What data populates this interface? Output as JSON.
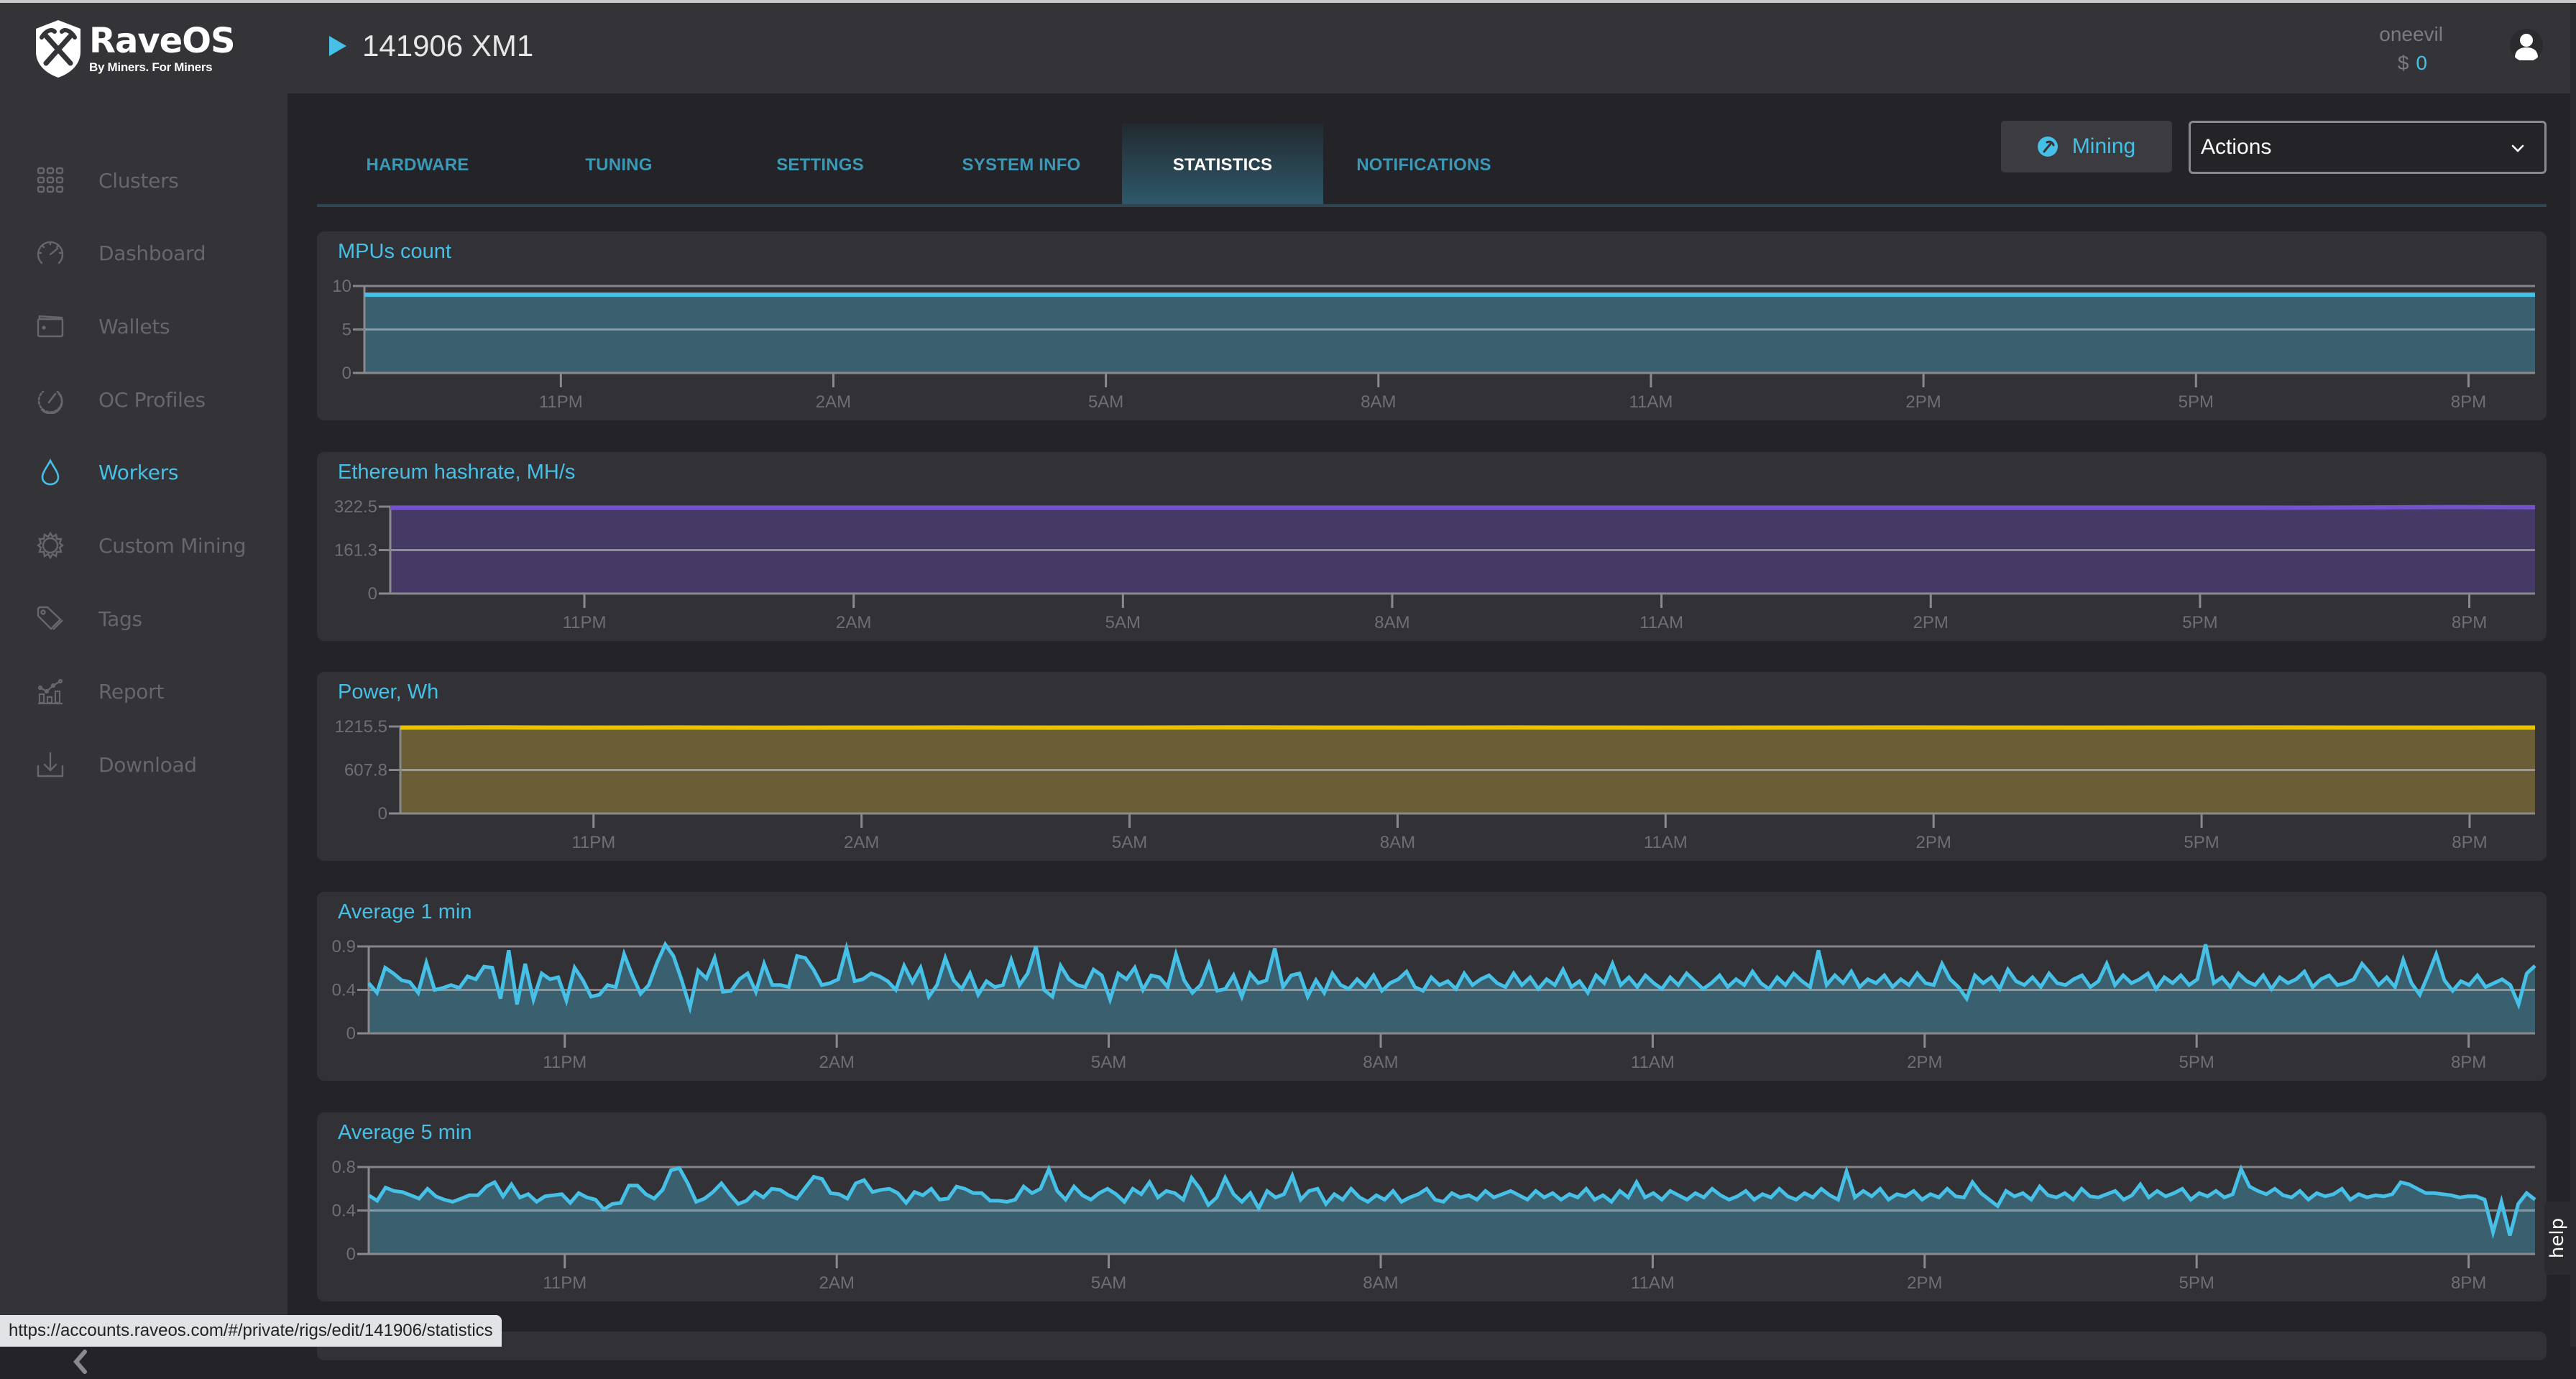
{
  "app": {
    "logo_name": "RaveOS",
    "logo_tagline": "By Miners. For Miners",
    "rig_title": "141906 XM1"
  },
  "user": {
    "name": "oneevil",
    "currency": "$",
    "balance": "0"
  },
  "sidebar": {
    "items": [
      {
        "label": "Clusters",
        "icon": "grid-icon",
        "active": false
      },
      {
        "label": "Dashboard",
        "icon": "speedometer-icon",
        "active": false
      },
      {
        "label": "Wallets",
        "icon": "wallet-icon",
        "active": false
      },
      {
        "label": "OC Profiles",
        "icon": "gauge-icon",
        "active": false
      },
      {
        "label": "Workers",
        "icon": "drop-icon",
        "active": true
      },
      {
        "label": "Custom Mining",
        "icon": "gear-icon",
        "active": false
      },
      {
        "label": "Tags",
        "icon": "tag-icon",
        "active": false
      },
      {
        "label": "Report",
        "icon": "chart-icon",
        "active": false
      },
      {
        "label": "Download",
        "icon": "download-icon",
        "active": false
      }
    ],
    "collapse_icon": "chevron-left-icon"
  },
  "tabs": [
    {
      "label": "HARDWARE",
      "active": false
    },
    {
      "label": "TUNING",
      "active": false
    },
    {
      "label": "SETTINGS",
      "active": false
    },
    {
      "label": "SYSTEM INFO",
      "active": false
    },
    {
      "label": "STATISTICS",
      "active": true
    },
    {
      "label": "NOTIFICATIONS",
      "active": false
    }
  ],
  "toolbar": {
    "mining_label": "Mining",
    "mining_icon": "pickaxe-icon",
    "actions_label": "Actions"
  },
  "help_label": "help",
  "status_url": "https://accounts.raveos.com/#/private/rigs/edit/141906/statistics",
  "colors": {
    "accent": "#46c0e6",
    "mpus_line": "#46c0e6",
    "mpus_fill": "#3a5f6e",
    "hashrate_line": "#7452cc",
    "hashrate_fill": "#453a66",
    "power_line": "#e6c200",
    "power_fill": "#6b5d36",
    "avg_line": "#46c0e6",
    "avg_fill": "#3a5f6e"
  },
  "chart_data": [
    {
      "type": "area",
      "title": "MPUs count",
      "x_ticks": [
        "11PM",
        "2AM",
        "5AM",
        "8AM",
        "11AM",
        "2PM",
        "5PM",
        "8PM"
      ],
      "y_ticks": [
        "0",
        "5",
        "10"
      ],
      "ylim": [
        0,
        10
      ],
      "grid": true,
      "series": [
        {
          "name": "MPUs count",
          "values": [
            9,
            9,
            9,
            9,
            9,
            9,
            9,
            9,
            9,
            9,
            9,
            9,
            9,
            9,
            9,
            9,
            9,
            9,
            9,
            9,
            9,
            9,
            9,
            9
          ]
        }
      ]
    },
    {
      "type": "area",
      "title": "Ethereum hashrate, MH/s",
      "x_ticks": [
        "11PM",
        "2AM",
        "5AM",
        "8AM",
        "11AM",
        "2PM",
        "5PM",
        "8PM"
      ],
      "y_ticks": [
        "0",
        "161.3",
        "322.5"
      ],
      "ylim": [
        0,
        322.5
      ],
      "grid": true,
      "series": [
        {
          "name": "Hashrate",
          "values": [
            318,
            318,
            318,
            318,
            318,
            318,
            318,
            318,
            318,
            318,
            318,
            318,
            318,
            318,
            318,
            318,
            318,
            318,
            318,
            318,
            318,
            319,
            321,
            320
          ]
        }
      ]
    },
    {
      "type": "area",
      "title": "Power, Wh",
      "x_ticks": [
        "11PM",
        "2AM",
        "5AM",
        "8AM",
        "11AM",
        "2PM",
        "5PM",
        "8PM"
      ],
      "y_ticks": [
        "0",
        "607.8",
        "1215.5"
      ],
      "ylim": [
        0,
        1215.5
      ],
      "grid": true,
      "series": [
        {
          "name": "Power",
          "values": [
            1200,
            1202,
            1199,
            1201,
            1198,
            1200,
            1201,
            1199,
            1200,
            1202,
            1200,
            1199,
            1201,
            1200,
            1198,
            1200,
            1201,
            1200,
            1199,
            1200,
            1201,
            1200,
            1199,
            1200
          ]
        }
      ]
    },
    {
      "type": "area",
      "title": "Average 1 min",
      "x_ticks": [
        "11PM",
        "2AM",
        "5AM",
        "8AM",
        "11AM",
        "2PM",
        "5PM",
        "8PM"
      ],
      "y_ticks": [
        "0",
        "0.4",
        "0.9"
      ],
      "ylim": [
        0,
        0.9
      ],
      "grid": true,
      "series": [
        {
          "name": "Average 1 min",
          "values": [
            0.52,
            0.42,
            0.68,
            0.62,
            0.55,
            0.53,
            0.42,
            0.73,
            0.45,
            0.47,
            0.5,
            0.47,
            0.59,
            0.56,
            0.69,
            0.68,
            0.36,
            0.86,
            0.3,
            0.72,
            0.35,
            0.62,
            0.56,
            0.58,
            0.34,
            0.68,
            0.55,
            0.38,
            0.4,
            0.5,
            0.48,
            0.82,
            0.6,
            0.41,
            0.5,
            0.73,
            0.92,
            0.8,
            0.55,
            0.27,
            0.65,
            0.57,
            0.78,
            0.43,
            0.44,
            0.56,
            0.62,
            0.43,
            0.72,
            0.5,
            0.5,
            0.48,
            0.8,
            0.78,
            0.66,
            0.5,
            0.52,
            0.56,
            0.88,
            0.54,
            0.56,
            0.62,
            0.59,
            0.54,
            0.45,
            0.7,
            0.53,
            0.68,
            0.38,
            0.5,
            0.78,
            0.55,
            0.46,
            0.62,
            0.4,
            0.54,
            0.48,
            0.5,
            0.76,
            0.5,
            0.62,
            0.9,
            0.45,
            0.38,
            0.7,
            0.56,
            0.5,
            0.48,
            0.66,
            0.6,
            0.35,
            0.62,
            0.56,
            0.68,
            0.45,
            0.6,
            0.58,
            0.48,
            0.82,
            0.55,
            0.42,
            0.5,
            0.72,
            0.44,
            0.46,
            0.6,
            0.38,
            0.62,
            0.52,
            0.55,
            0.88,
            0.48,
            0.6,
            0.62,
            0.38,
            0.55,
            0.42,
            0.62,
            0.5,
            0.46,
            0.56,
            0.48,
            0.6,
            0.44,
            0.52,
            0.56,
            0.64,
            0.48,
            0.44,
            0.58,
            0.5,
            0.54,
            0.46,
            0.62,
            0.5,
            0.56,
            0.6,
            0.52,
            0.48,
            0.62,
            0.5,
            0.58,
            0.46,
            0.56,
            0.5,
            0.66,
            0.48,
            0.54,
            0.42,
            0.6,
            0.52,
            0.72,
            0.5,
            0.58,
            0.48,
            0.6,
            0.52,
            0.46,
            0.58,
            0.5,
            0.62,
            0.54,
            0.46,
            0.52,
            0.6,
            0.48,
            0.56,
            0.5,
            0.64,
            0.52,
            0.46,
            0.58,
            0.5,
            0.62,
            0.54,
            0.48,
            0.86,
            0.5,
            0.6,
            0.52,
            0.64,
            0.48,
            0.56,
            0.52,
            0.6,
            0.48,
            0.56,
            0.5,
            0.62,
            0.52,
            0.5,
            0.72,
            0.56,
            0.48,
            0.36,
            0.6,
            0.52,
            0.58,
            0.46,
            0.66,
            0.54,
            0.5,
            0.58,
            0.48,
            0.62,
            0.52,
            0.5,
            0.56,
            0.6,
            0.48,
            0.54,
            0.72,
            0.5,
            0.6,
            0.52,
            0.56,
            0.62,
            0.46,
            0.58,
            0.52,
            0.6,
            0.5,
            0.56,
            0.92,
            0.52,
            0.58,
            0.48,
            0.62,
            0.54,
            0.5,
            0.6,
            0.46,
            0.58,
            0.52,
            0.56,
            0.64,
            0.48,
            0.56,
            0.6,
            0.5,
            0.52,
            0.56,
            0.72,
            0.62,
            0.5,
            0.58,
            0.48,
            0.76,
            0.52,
            0.4,
            0.6,
            0.82,
            0.55,
            0.44,
            0.54,
            0.5,
            0.6,
            0.48,
            0.52,
            0.56,
            0.5,
            0.3,
            0.62,
            0.7
          ]
        }
      ]
    },
    {
      "type": "area",
      "title": "Average 5 min",
      "x_ticks": [
        "11PM",
        "2AM",
        "5AM",
        "8AM",
        "11AM",
        "2PM",
        "5PM",
        "8PM"
      ],
      "y_ticks": [
        "0",
        "0.4",
        "0.8"
      ],
      "ylim": [
        0,
        0.8
      ],
      "grid": true,
      "series": [
        {
          "name": "Average 5 min",
          "values": [
            0.54,
            0.49,
            0.61,
            0.58,
            0.57,
            0.54,
            0.51,
            0.6,
            0.53,
            0.5,
            0.48,
            0.51,
            0.54,
            0.54,
            0.62,
            0.66,
            0.53,
            0.64,
            0.52,
            0.55,
            0.48,
            0.53,
            0.54,
            0.55,
            0.47,
            0.56,
            0.52,
            0.5,
            0.41,
            0.46,
            0.47,
            0.63,
            0.63,
            0.55,
            0.51,
            0.59,
            0.77,
            0.79,
            0.65,
            0.48,
            0.51,
            0.57,
            0.65,
            0.55,
            0.46,
            0.49,
            0.57,
            0.52,
            0.6,
            0.59,
            0.54,
            0.51,
            0.61,
            0.71,
            0.69,
            0.56,
            0.55,
            0.51,
            0.65,
            0.68,
            0.57,
            0.59,
            0.6,
            0.56,
            0.47,
            0.57,
            0.54,
            0.6,
            0.5,
            0.51,
            0.62,
            0.6,
            0.56,
            0.56,
            0.49,
            0.49,
            0.48,
            0.5,
            0.62,
            0.56,
            0.6,
            0.78,
            0.58,
            0.5,
            0.62,
            0.54,
            0.5,
            0.56,
            0.6,
            0.55,
            0.48,
            0.6,
            0.55,
            0.66,
            0.52,
            0.58,
            0.56,
            0.5,
            0.7,
            0.6,
            0.45,
            0.52,
            0.7,
            0.55,
            0.48,
            0.56,
            0.42,
            0.58,
            0.52,
            0.55,
            0.72,
            0.5,
            0.58,
            0.6,
            0.46,
            0.55,
            0.5,
            0.6,
            0.52,
            0.48,
            0.54,
            0.5,
            0.58,
            0.48,
            0.52,
            0.55,
            0.6,
            0.5,
            0.48,
            0.56,
            0.52,
            0.54,
            0.5,
            0.58,
            0.52,
            0.55,
            0.58,
            0.54,
            0.5,
            0.58,
            0.52,
            0.56,
            0.5,
            0.55,
            0.52,
            0.6,
            0.5,
            0.54,
            0.48,
            0.58,
            0.52,
            0.66,
            0.52,
            0.56,
            0.5,
            0.58,
            0.54,
            0.5,
            0.56,
            0.52,
            0.6,
            0.54,
            0.5,
            0.53,
            0.58,
            0.5,
            0.55,
            0.52,
            0.6,
            0.53,
            0.5,
            0.56,
            0.52,
            0.6,
            0.54,
            0.5,
            0.76,
            0.52,
            0.58,
            0.53,
            0.6,
            0.5,
            0.55,
            0.53,
            0.58,
            0.5,
            0.55,
            0.52,
            0.6,
            0.53,
            0.52,
            0.66,
            0.56,
            0.5,
            0.44,
            0.58,
            0.53,
            0.56,
            0.5,
            0.62,
            0.54,
            0.52,
            0.56,
            0.5,
            0.6,
            0.53,
            0.52,
            0.55,
            0.58,
            0.5,
            0.54,
            0.64,
            0.52,
            0.58,
            0.53,
            0.56,
            0.6,
            0.5,
            0.56,
            0.53,
            0.58,
            0.52,
            0.55,
            0.78,
            0.62,
            0.58,
            0.55,
            0.6,
            0.54,
            0.52,
            0.58,
            0.5,
            0.56,
            0.53,
            0.55,
            0.6,
            0.5,
            0.55,
            0.52,
            0.54,
            0.53,
            0.55,
            0.66,
            0.64,
            0.6,
            0.56,
            0.56,
            0.55,
            0.54,
            0.52,
            0.53,
            0.53,
            0.5,
            0.2,
            0.48,
            0.17,
            0.46,
            0.56,
            0.5
          ]
        }
      ]
    }
  ]
}
